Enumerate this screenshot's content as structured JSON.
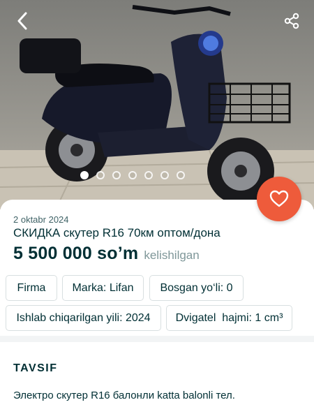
{
  "nav": {
    "back_icon": "chevron-left-icon",
    "share_icon": "share-icon"
  },
  "gallery": {
    "image_count": 7,
    "active_index": 0,
    "subject": "electric scooter photo"
  },
  "favorite": {
    "icon": "heart-icon",
    "color": "#ee5b3b"
  },
  "listing": {
    "date": "2 oktabr 2024",
    "title": "СКИДКА скутер R16 70км  оптом/дона",
    "price": "5 500 000 so’m",
    "negotiable": "kelishilgan"
  },
  "params": [
    "Firma",
    "Marka: Lifan",
    "Bosgan yo‘li: 0",
    "Ishlab chiqarilgan yili: 2024",
    "Dvigatel  hajmi: 1 cm³"
  ],
  "description": {
    "heading": "TAVSIF",
    "line1": "Электро скутер R16 балонли katta balonli тел."
  }
}
